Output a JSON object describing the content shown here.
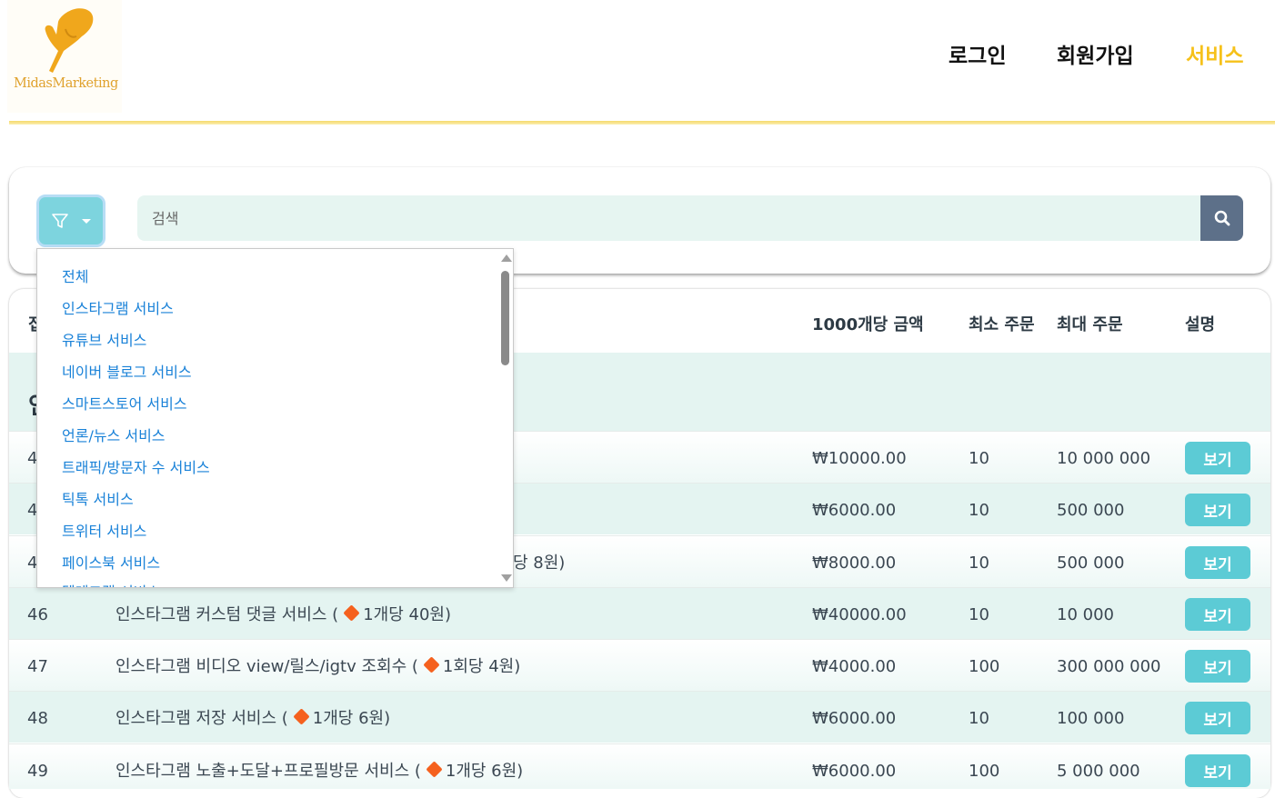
{
  "header": {
    "logo_text": "MidasMarketing",
    "nav": {
      "login": "로그인",
      "signup": "회원가입",
      "service": "서비스"
    },
    "accent_color": "#f6c11a"
  },
  "search": {
    "placeholder": "검색",
    "filter_icon": "filter-icon",
    "search_icon": "search-icon"
  },
  "dropdown": {
    "items": [
      "전체",
      "인스타그램 서비스",
      "유튜브 서비스",
      "네이버 블로그 서비스",
      "스마트스토어 서비스",
      "언론/뉴스 서비스",
      "트래픽/방문자 수 서비스",
      "틱톡 서비스",
      "트위터 서비스",
      "페이스북 서비스",
      "텔레그램 서비스"
    ]
  },
  "table": {
    "headers": {
      "id": "접",
      "price": "1000개당 금액",
      "min": "최소 주문",
      "max": "최대 주문",
      "desc": "설명"
    },
    "group_title": "인",
    "rows": [
      {
        "id": "4",
        "name": "",
        "price": "₩10000.00",
        "min": "10",
        "max": "10 000 000",
        "button": "보기"
      },
      {
        "id": "4",
        "name": "",
        "price": "₩6000.00",
        "min": "10",
        "max": "500 000",
        "button": "보기"
      },
      {
        "id": "4",
        "name": "당 8원)",
        "price": "₩8000.00",
        "min": "10",
        "max": "500 000",
        "button": "보기"
      },
      {
        "id": "46",
        "name": "인스타그램 커스텀 댓글 서비스 (",
        "unit": "1개당 40원)",
        "price": "₩40000.00",
        "min": "10",
        "max": "10 000",
        "button": "보기"
      },
      {
        "id": "47",
        "name": "인스타그램 비디오 view/릴스/igtv 조회수 (",
        "unit": "1회당 4원)",
        "price": "₩4000.00",
        "min": "100",
        "max": "300 000 000",
        "button": "보기"
      },
      {
        "id": "48",
        "name": "인스타그램 저장 서비스 (",
        "unit": "1개당 6원)",
        "price": "₩6000.00",
        "min": "10",
        "max": "100 000",
        "button": "보기"
      },
      {
        "id": "49",
        "name": "인스타그램 노출+도달+프로필방문 서비스 (",
        "unit": "1개당 6원)",
        "price": "₩6000.00",
        "min": "100",
        "max": "5 000 000",
        "button": "보기"
      }
    ]
  }
}
